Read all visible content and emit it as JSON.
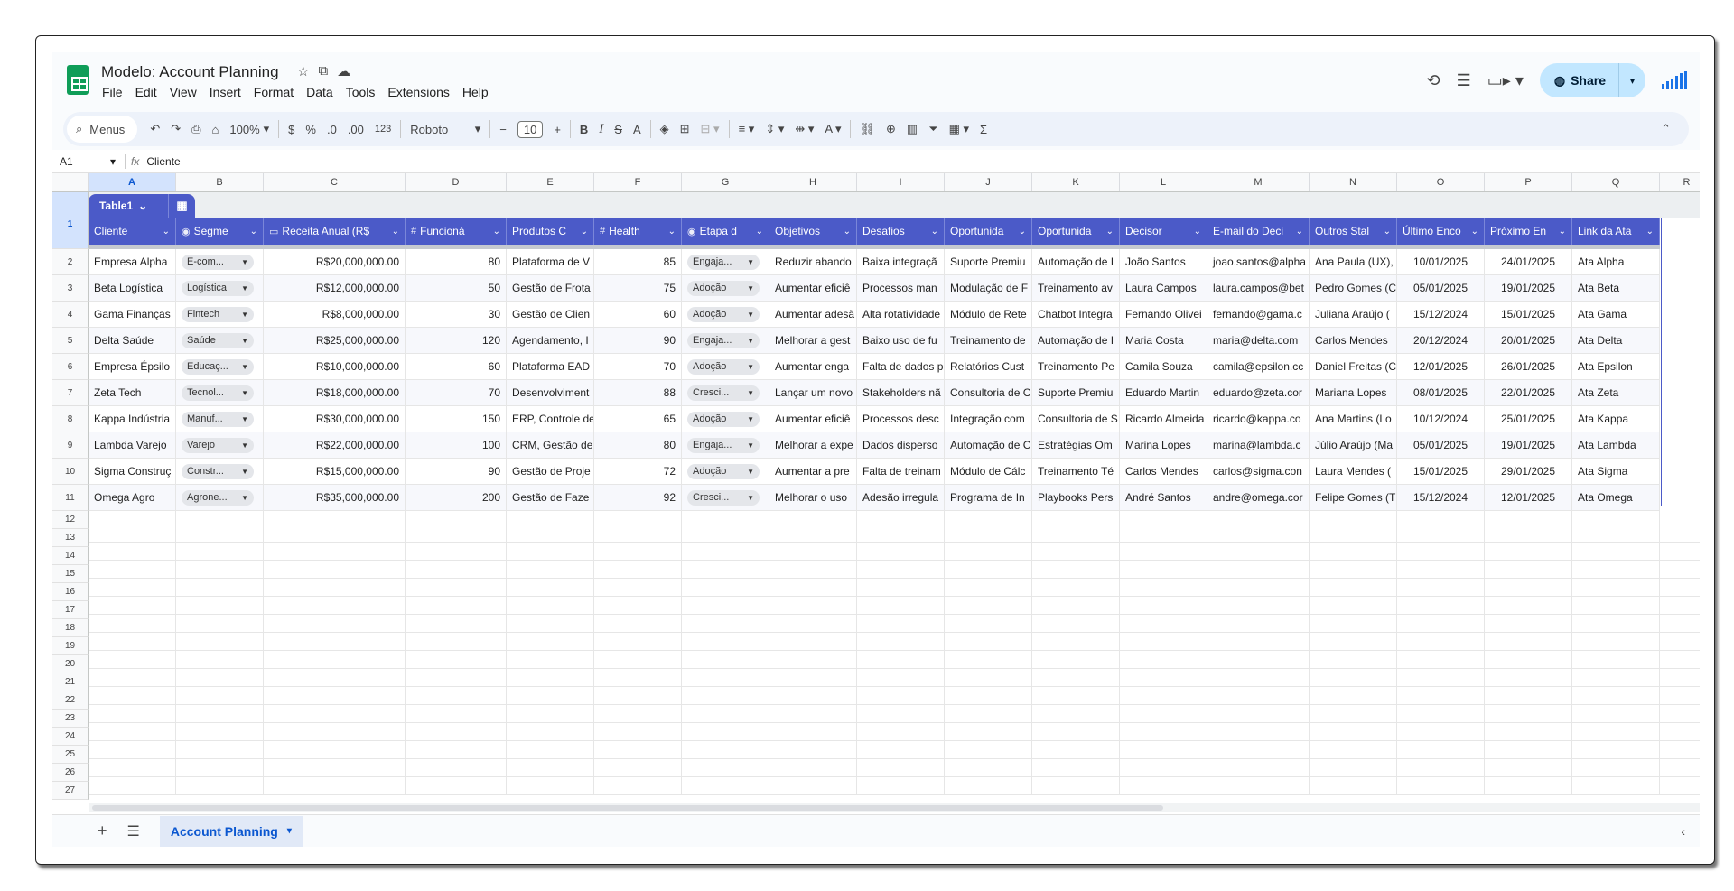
{
  "doc": {
    "title": "Modelo: Account Planning"
  },
  "menu": [
    "File",
    "Edit",
    "View",
    "Insert",
    "Format",
    "Data",
    "Tools",
    "Extensions",
    "Help"
  ],
  "share": {
    "label": "Share"
  },
  "toolbar": {
    "search": "Menus",
    "zoom": "100%",
    "currency": "$",
    "percent": "%",
    "dec_less": ".0",
    "dec_more": ".00",
    "numfmt": "123",
    "font": "Roboto",
    "font_size": "10"
  },
  "formula_bar": {
    "cell": "A1",
    "content": "Cliente"
  },
  "columns": [
    "A",
    "B",
    "C",
    "D",
    "E",
    "F",
    "G",
    "H",
    "I",
    "J",
    "K",
    "L",
    "M",
    "N",
    "O",
    "P",
    "Q",
    "R"
  ],
  "table": {
    "name": "Table1",
    "headers": [
      {
        "label": "Cliente",
        "type": ""
      },
      {
        "label": "Segme",
        "type": "◉"
      },
      {
        "label": "Receita Anual (R$",
        "type": "▭"
      },
      {
        "label": "Funcioná",
        "type": "#"
      },
      {
        "label": "Produtos C",
        "type": ""
      },
      {
        "label": "Health",
        "type": "#"
      },
      {
        "label": "Etapa d",
        "type": "◉"
      },
      {
        "label": "Objetivos",
        "type": ""
      },
      {
        "label": "Desafios",
        "type": ""
      },
      {
        "label": "Oportunida",
        "type": ""
      },
      {
        "label": "Oportunida",
        "type": ""
      },
      {
        "label": "Decisor",
        "type": ""
      },
      {
        "label": "E-mail do Deci",
        "type": ""
      },
      {
        "label": "Outros Stal",
        "type": ""
      },
      {
        "label": "Último Enco",
        "type": ""
      },
      {
        "label": "Próximo En",
        "type": ""
      },
      {
        "label": "Link da Ata",
        "type": ""
      }
    ],
    "rows": [
      [
        "Empresa Alpha",
        "E-com...",
        "R$20,000,000.00",
        "80",
        "Plataforma de V",
        "85",
        "Engaja...",
        "Reduzir abando",
        "Baixa integraçã",
        "Suporte Premiu",
        "Automação de I",
        "João Santos",
        "joao.santos@alpha",
        "Ana Paula (UX),",
        "10/01/2025",
        "24/01/2025",
        "Ata Alpha"
      ],
      [
        "Beta Logística",
        "Logística",
        "R$12,000,000.00",
        "50",
        "Gestão de Frota",
        "75",
        "Adoção",
        "Aumentar eficiê",
        "Processos man",
        "Modulação de F",
        "Treinamento av",
        "Laura Campos",
        "laura.campos@bet",
        "Pedro Gomes (C",
        "05/01/2025",
        "19/01/2025",
        "Ata Beta"
      ],
      [
        "Gama Finanças",
        "Fintech",
        "R$8,000,000.00",
        "30",
        "Gestão de Clien",
        "60",
        "Adoção",
        "Aumentar adesã",
        "Alta rotatividade",
        "Módulo de Rete",
        "Chatbot Integra",
        "Fernando Olivei",
        "fernando@gama.c",
        "Juliana Araújo (",
        "15/12/2024",
        "15/01/2025",
        "Ata Gama"
      ],
      [
        "Delta Saúde",
        "Saúde",
        "R$25,000,000.00",
        "120",
        "Agendamento, I",
        "90",
        "Engaja...",
        "Melhorar a gest",
        "Baixo uso de fu",
        "Treinamento de",
        "Automação de I",
        "Maria Costa",
        "maria@delta.com",
        "Carlos Mendes",
        "20/12/2024",
        "20/01/2025",
        "Ata Delta"
      ],
      [
        "Empresa Épsilo",
        "Educaç...",
        "R$10,000,000.00",
        "60",
        "Plataforma EAD",
        "70",
        "Adoção",
        "Aumentar enga",
        "Falta de dados p",
        "Relatórios Cust",
        "Treinamento Pe",
        "Camila Souza",
        "camila@epsilon.cc",
        "Daniel Freitas (C",
        "12/01/2025",
        "26/01/2025",
        "Ata Epsilon"
      ],
      [
        "Zeta Tech",
        "Tecnol...",
        "R$18,000,000.00",
        "70",
        "Desenvolviment",
        "88",
        "Cresci...",
        "Lançar um novo",
        "Stakeholders nã",
        "Consultoria de C",
        "Suporte Premiu",
        "Eduardo Martin",
        "eduardo@zeta.cor",
        "Mariana Lopes",
        "08/01/2025",
        "22/01/2025",
        "Ata Zeta"
      ],
      [
        "Kappa Indústria",
        "Manuf...",
        "R$30,000,000.00",
        "150",
        "ERP, Controle de",
        "65",
        "Adoção",
        "Aumentar eficiê",
        "Processos desc",
        "Integração com",
        "Consultoria de S",
        "Ricardo Almeida",
        "ricardo@kappa.co",
        "Ana Martins (Lo",
        "10/12/2024",
        "25/01/2025",
        "Ata Kappa"
      ],
      [
        "Lambda Varejo",
        "Varejo",
        "R$22,000,000.00",
        "100",
        "CRM, Gestão de",
        "80",
        "Engaja...",
        "Melhorar a expe",
        "Dados disperso",
        "Automação de C",
        "Estratégias Om",
        "Marina Lopes",
        "marina@lambda.c",
        "Júlio Araújo (Ma",
        "05/01/2025",
        "19/01/2025",
        "Ata Lambda"
      ],
      [
        "Sigma Construç",
        "Constr...",
        "R$15,000,000.00",
        "90",
        "Gestão de Proje",
        "72",
        "Adoção",
        "Aumentar a pre",
        "Falta de treinam",
        "Módulo de Cálc",
        "Treinamento Té",
        "Carlos Mendes",
        "carlos@sigma.con",
        "Laura Mendes (",
        "15/01/2025",
        "29/01/2025",
        "Ata Sigma"
      ],
      [
        "Omega Agro",
        "Agrone...",
        "R$35,000,000.00",
        "200",
        "Gestão de Faze",
        "92",
        "Cresci...",
        "Melhorar o uso",
        "Adesão irregula",
        "Programa de In",
        "Playbooks Pers",
        "André Santos",
        "andre@omega.cor",
        "Felipe Gomes (T",
        "15/12/2024",
        "12/01/2025",
        "Ata Omega"
      ]
    ]
  },
  "row_numbers": [
    "1",
    "2",
    "3",
    "4",
    "5",
    "6",
    "7",
    "8",
    "9",
    "10",
    "11",
    "12",
    "13",
    "14",
    "15",
    "16",
    "17",
    "18",
    "19",
    "20",
    "21",
    "22",
    "23",
    "24",
    "25",
    "26",
    "27"
  ],
  "sheet_tab": {
    "label": "Account Planning"
  },
  "colors": {
    "accent": "#4b5ac8",
    "share_bg": "#c2e7ff",
    "logo": "#0f9d58"
  }
}
